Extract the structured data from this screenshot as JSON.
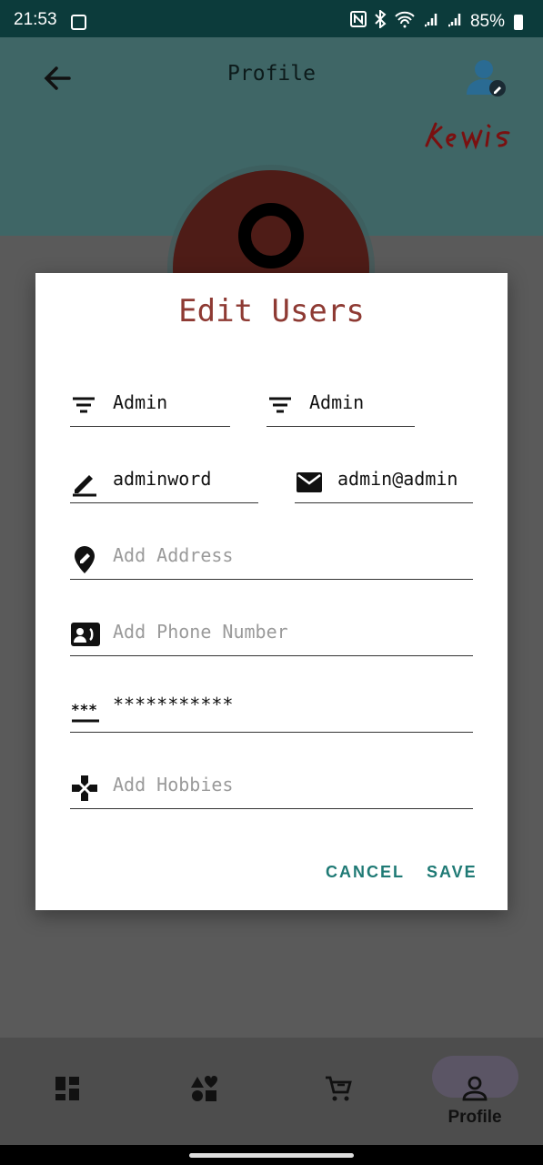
{
  "status": {
    "time": "21:53",
    "battery": "85%"
  },
  "appbar": {
    "title": "Profile",
    "logo_text": "Kewis"
  },
  "dialog": {
    "title": "Edit Users",
    "first_name": "Admin",
    "last_name": "Admin",
    "username": "adminword",
    "email": "admin@admin",
    "address_placeholder": "Add Address",
    "phone_placeholder": "Add Phone Number",
    "password": "***********",
    "hobbies_placeholder": "Add Hobbies",
    "cancel_label": "CANCEL",
    "save_label": "SAVE"
  },
  "nav": {
    "profile_label": "Profile"
  },
  "colors": {
    "accent": "#1f7a75",
    "title": "#8e3a33",
    "statusbar": "#0c3b3b"
  }
}
